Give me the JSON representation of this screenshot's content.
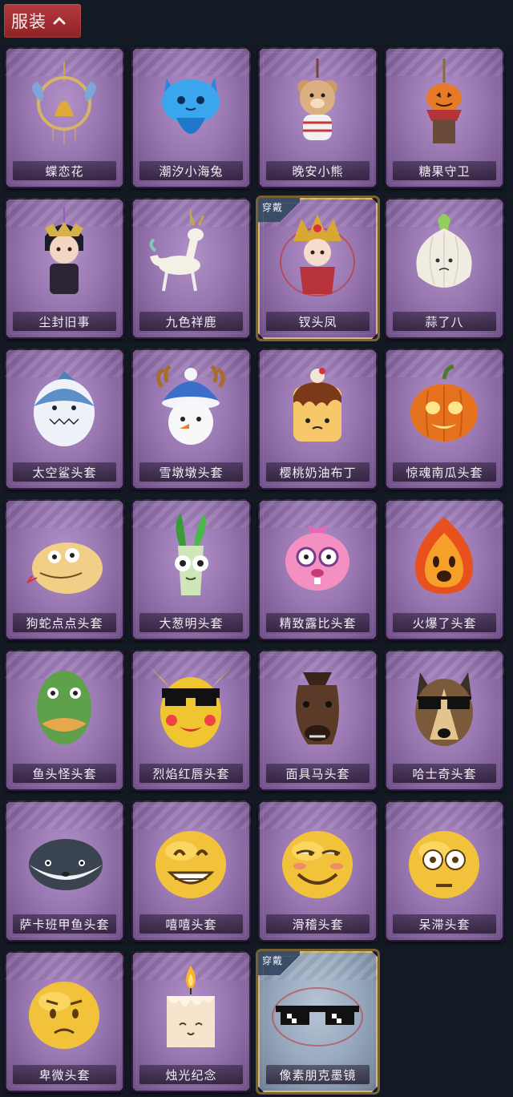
{
  "section": {
    "title": "服装",
    "toggle_icon": "chevron-up-icon"
  },
  "equipped_label": "穿戴",
  "items": [
    {
      "name": "蝶恋花",
      "icon": "butterfly-bell-icon",
      "equipped": false
    },
    {
      "name": "潮汐小海兔",
      "icon": "blue-sea-bunny-icon",
      "equipped": false
    },
    {
      "name": "晚安小熊",
      "icon": "teddy-bear-icon",
      "equipped": false
    },
    {
      "name": "糖果守卫",
      "icon": "pumpkin-scarecrow-icon",
      "equipped": false
    },
    {
      "name": "尘封旧事",
      "icon": "chibi-prince-icon",
      "equipped": false
    },
    {
      "name": "九色祥鹿",
      "icon": "white-deer-icon",
      "equipped": false
    },
    {
      "name": "钗头凤",
      "icon": "phoenix-crown-doll-icon",
      "equipped": true
    },
    {
      "name": "蒜了八",
      "icon": "garlic-icon",
      "equipped": false
    },
    {
      "name": "太空鲨头套",
      "icon": "shark-helmet-icon",
      "equipped": false
    },
    {
      "name": "雪墩墩头套",
      "icon": "snowman-reindeer-icon",
      "equipped": false
    },
    {
      "name": "樱桃奶油布丁",
      "icon": "pudding-icon",
      "equipped": false
    },
    {
      "name": "惊魂南瓜头套",
      "icon": "jack-o-lantern-icon",
      "equipped": false
    },
    {
      "name": "狗蛇点点头套",
      "icon": "snake-dog-icon",
      "equipped": false
    },
    {
      "name": "大葱明头套",
      "icon": "green-onion-icon",
      "equipped": false
    },
    {
      "name": "精致露比头套",
      "icon": "pink-beaver-icon",
      "equipped": false
    },
    {
      "name": "火爆了头套",
      "icon": "fire-spirit-icon",
      "equipped": false
    },
    {
      "name": "鱼头怪头套",
      "icon": "fish-head-icon",
      "equipped": false
    },
    {
      "name": "烈焰红唇头套",
      "icon": "pikachu-sunglasses-icon",
      "equipped": false
    },
    {
      "name": "面具马头套",
      "icon": "horse-mask-icon",
      "equipped": false
    },
    {
      "name": "哈士奇头套",
      "icon": "husky-sunglasses-icon",
      "equipped": false
    },
    {
      "name": "萨卡班甲鱼头套",
      "icon": "sacabambaspis-icon",
      "equipped": false
    },
    {
      "name": "嘻嘻头套",
      "icon": "grin-emoji-icon",
      "equipped": false
    },
    {
      "name": "滑稽头套",
      "icon": "funny-emoji-icon",
      "equipped": false
    },
    {
      "name": "呆滞头套",
      "icon": "stunned-emoji-icon",
      "equipped": false
    },
    {
      "name": "卑微头套",
      "icon": "humble-emoji-icon",
      "equipped": false
    },
    {
      "name": "烛光纪念",
      "icon": "candle-icon",
      "equipped": false
    },
    {
      "name": "像素朋克墨镜",
      "icon": "pixel-sunglasses-icon",
      "equipped": true
    }
  ],
  "colors": {
    "background": "#141a24",
    "card": "#9877b1",
    "tab": "#a32d31",
    "equipped_border": "#d9b86a"
  }
}
